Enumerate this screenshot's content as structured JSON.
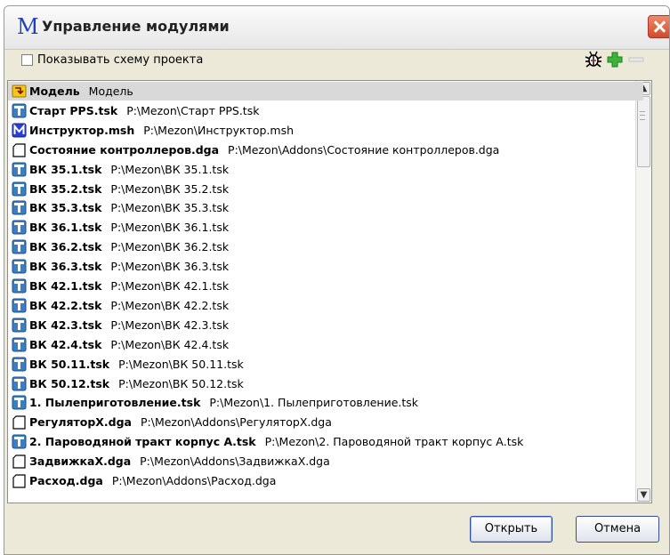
{
  "window": {
    "title": "Управление модулями",
    "app_icon_letter": "M"
  },
  "toolbar": {
    "show_scheme_label": "Показывать схему проекта",
    "show_scheme_checked": false
  },
  "modules": [
    {
      "name": "Модель",
      "path": "Модель",
      "icon": "model-icon",
      "selected": true
    },
    {
      "name": "Старт PPS.tsk",
      "path": "P:\\Mezon\\Старт PPS.tsk",
      "icon": "task-icon"
    },
    {
      "name": "Инструктор.msh",
      "path": "P:\\Mezon\\Инструктор.msh",
      "icon": "mezon-icon"
    },
    {
      "name": "Состояние контроллеров.dga",
      "path": "P:\\Mezon\\Addons\\Состояние контроллеров.dga",
      "icon": "dga-icon"
    },
    {
      "name": "ВК 35.1.tsk",
      "path": "P:\\Mezon\\ВК 35.1.tsk",
      "icon": "task-icon"
    },
    {
      "name": "ВК 35.2.tsk",
      "path": "P:\\Mezon\\ВК 35.2.tsk",
      "icon": "task-icon"
    },
    {
      "name": "ВК 35.3.tsk",
      "path": "P:\\Mezon\\ВК 35.3.tsk",
      "icon": "task-icon"
    },
    {
      "name": "ВК 36.1.tsk",
      "path": "P:\\Mezon\\ВК 36.1.tsk",
      "icon": "task-icon"
    },
    {
      "name": "ВК 36.2.tsk",
      "path": "P:\\Mezon\\ВК 36.2.tsk",
      "icon": "task-icon"
    },
    {
      "name": "ВК 36.3.tsk",
      "path": "P:\\Mezon\\ВК 36.3.tsk",
      "icon": "task-icon"
    },
    {
      "name": "ВК 42.1.tsk",
      "path": "P:\\Mezon\\ВК 42.1.tsk",
      "icon": "task-icon"
    },
    {
      "name": "ВК 42.2.tsk",
      "path": "P:\\Mezon\\ВК 42.2.tsk",
      "icon": "task-icon"
    },
    {
      "name": "ВК 42.3.tsk",
      "path": "P:\\Mezon\\ВК 42.3.tsk",
      "icon": "task-icon"
    },
    {
      "name": "ВК 42.4.tsk",
      "path": "P:\\Mezon\\ВК 42.4.tsk",
      "icon": "task-icon"
    },
    {
      "name": "ВК 50.11.tsk",
      "path": "P:\\Mezon\\ВК 50.11.tsk",
      "icon": "task-icon"
    },
    {
      "name": "ВК 50.12.tsk",
      "path": "P:\\Mezon\\ВК 50.12.tsk",
      "icon": "task-icon"
    },
    {
      "name": "1. Пылеприготовление.tsk",
      "path": "P:\\Mezon\\1. Пылеприготовление.tsk",
      "icon": "task-icon"
    },
    {
      "name": "РегуляторX.dga",
      "path": "P:\\Mezon\\Addons\\РегуляторX.dga",
      "icon": "dga-icon"
    },
    {
      "name": "2. Пароводяной тракт корпус А.tsk",
      "path": "P:\\Mezon\\2. Пароводяной тракт корпус А.tsk",
      "icon": "task-icon"
    },
    {
      "name": "ЗадвижкаX.dga",
      "path": "P:\\Mezon\\Addons\\ЗадвижкаX.dga",
      "icon": "dga-icon"
    },
    {
      "name": "Расход.dga",
      "path": "P:\\Mezon\\Addons\\Расход.dga",
      "icon": "dga-icon"
    }
  ],
  "buttons": {
    "open": "Открыть",
    "cancel": "Отмена"
  },
  "colors": {
    "selected_row": "#d9d9d9",
    "task_icon": "#3a7fc4",
    "mezon_icon": "#2a3fd0",
    "model_icon": "#f2c81b",
    "add_icon": "#3cb43c"
  }
}
